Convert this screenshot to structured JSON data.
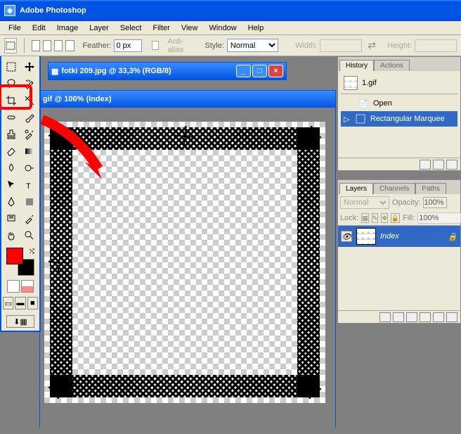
{
  "app": {
    "title": "Adobe Photoshop"
  },
  "menu": [
    "File",
    "Edit",
    "Image",
    "Layer",
    "Select",
    "Filter",
    "View",
    "Window",
    "Help"
  ],
  "options": {
    "feather_label": "Feather:",
    "feather_value": "0 px",
    "antialias_label": "Anti-alias",
    "style_label": "Style:",
    "style_value": "Normal",
    "width_label": "Width:",
    "height_label": "Height:"
  },
  "documents": {
    "back": {
      "title": "fotki 209.jpg @ 33,3% (RGB/8)"
    },
    "front": {
      "title": "gif @ 100% (Index)"
    }
  },
  "history": {
    "tab1": "History",
    "tab2": "Actions",
    "snapshot": "1.gif",
    "items": [
      "Open",
      "Rectangular Marquee"
    ]
  },
  "layers": {
    "tab1": "Layers",
    "tab2": "Channels",
    "tab3": "Paths",
    "blend": "Normal",
    "opacity_label": "Opacity:",
    "opacity_value": "100%",
    "lock_label": "Lock:",
    "fill_label": "Fill:",
    "fill_value": "100%",
    "layer_name": "Index"
  }
}
